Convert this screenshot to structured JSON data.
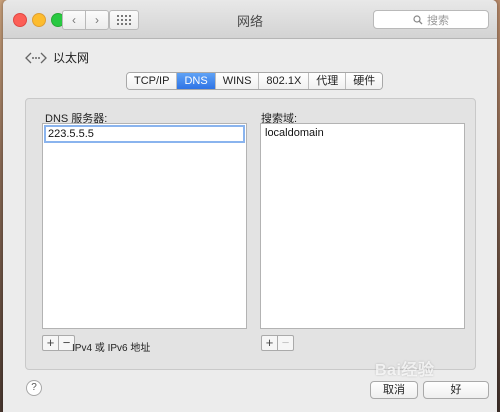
{
  "window": {
    "title": "网络"
  },
  "toolbar": {
    "search_placeholder": "搜索"
  },
  "breadcrumb": {
    "back_label": "以太网"
  },
  "tabs": [
    {
      "label": "TCP/IP",
      "active": false
    },
    {
      "label": "DNS",
      "active": true
    },
    {
      "label": "WINS",
      "active": false
    },
    {
      "label": "802.1X",
      "active": false
    },
    {
      "label": "代理",
      "active": false
    },
    {
      "label": "硬件",
      "active": false
    }
  ],
  "dns": {
    "label": "DNS 服务器:",
    "servers": [
      "223.5.5.5"
    ],
    "hint": "IPv4 或 IPv6 地址"
  },
  "search_domains": {
    "label": "搜索域:",
    "domains": [
      "localdomain"
    ]
  },
  "buttons": {
    "help": "?",
    "cancel": "取消",
    "ok": "好"
  },
  "watermark": {
    "text": "Bai经验"
  },
  "colors": {
    "accent": "#2e74e6",
    "selection_outline": "#8ab4ee"
  }
}
